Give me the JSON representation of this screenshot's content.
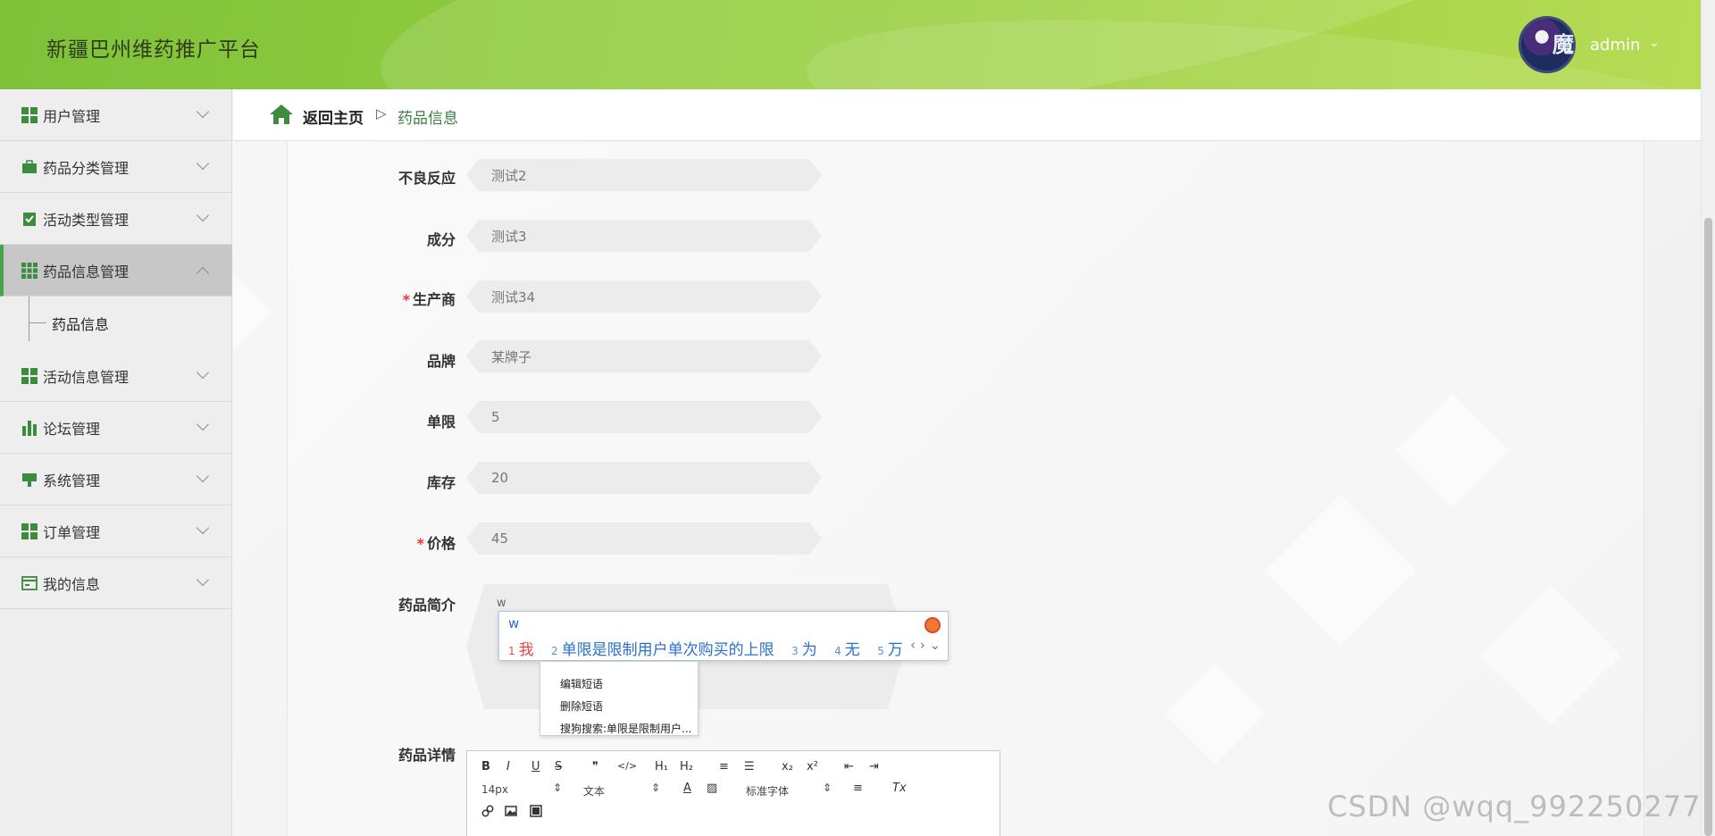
{
  "header": {
    "app_title": "新疆巴州维药推广平台",
    "user_name": "admin",
    "avatar_text": "魔",
    "caret": "⌄"
  },
  "sidebar": {
    "items": [
      {
        "label": "用户管理",
        "icon": "grid-icon"
      },
      {
        "label": "药品分类管理",
        "icon": "briefcase-icon"
      },
      {
        "label": "活动类型管理",
        "icon": "clipboard-check-icon"
      },
      {
        "label": "药品信息管理",
        "icon": "grid-9-icon",
        "active": true
      },
      {
        "label": "活动信息管理",
        "icon": "grid-icon"
      },
      {
        "label": "论坛管理",
        "icon": "bar-chart-icon"
      },
      {
        "label": "系统管理",
        "icon": "monitor-icon"
      },
      {
        "label": "订单管理",
        "icon": "grid-icon"
      },
      {
        "label": "我的信息",
        "icon": "id-card-icon"
      }
    ],
    "sub_item": "药品信息"
  },
  "breadcrumb": {
    "home": "返回主页",
    "separator": "▷",
    "current": "药品信息"
  },
  "form": {
    "fields": [
      {
        "label": "不良反应",
        "value": "测试2",
        "required": false
      },
      {
        "label": "成分",
        "value": "测试3",
        "required": false
      },
      {
        "label": "生产商",
        "value": "测试34",
        "required": true
      },
      {
        "label": "品牌",
        "value": "某牌子",
        "required": false
      },
      {
        "label": "单限",
        "value": "5",
        "required": false
      },
      {
        "label": "库存",
        "value": "20",
        "required": false
      },
      {
        "label": "价格",
        "value": "45",
        "required": true
      }
    ],
    "required_mark": "*",
    "intro_label": "药品简介",
    "intro_value": "w",
    "detail_label": "药品详情"
  },
  "ime": {
    "typed": "w",
    "candidates": [
      {
        "n": "1",
        "text": "我"
      },
      {
        "n": "2",
        "text": "单限是限制用户单次购买的上限"
      },
      {
        "n": "3",
        "text": "为"
      },
      {
        "n": "4",
        "text": "无"
      },
      {
        "n": "5",
        "text": "万"
      }
    ],
    "nav": "‹ › ⌄",
    "menu": [
      "编辑短语",
      "删除短语",
      "搜狗搜索:单限是限制用户..."
    ]
  },
  "editor": {
    "row1": [
      "B",
      "I",
      "U",
      "S",
      "❞",
      "</>",
      "H₁",
      "H₂",
      "≡",
      "☰",
      "x₂",
      "x²",
      "⇤",
      "⇥"
    ],
    "font_size": "14px",
    "format": "文本",
    "font_family": "标准字体",
    "clear": "Tx"
  },
  "watermark": "CSDN @wqq_992250277",
  "colors": {
    "accent": "#49a34a",
    "header_green": "#9ad03f",
    "link_blue": "#2b6fcf",
    "required": "#e33"
  }
}
